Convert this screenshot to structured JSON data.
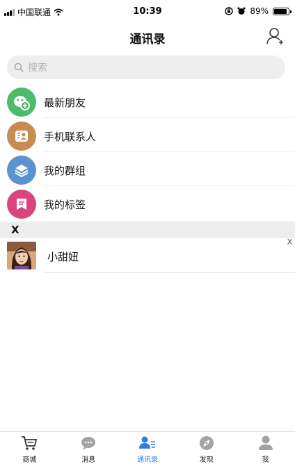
{
  "status_bar": {
    "carrier": "中国联通",
    "time": "10:39",
    "battery": "89%",
    "battery_level": 0.89
  },
  "nav": {
    "title": "通讯录",
    "add_friend_icon": "add-user-icon"
  },
  "search": {
    "placeholder": "搜索"
  },
  "menu": [
    {
      "label": "最新朋友",
      "icon": "new-friend-icon",
      "color": "#4cbb6c"
    },
    {
      "label": "手机联系人",
      "icon": "phone-contacts-icon",
      "color": "#c98b52"
    },
    {
      "label": "我的群组",
      "icon": "group-icon",
      "color": "#5b93d0"
    },
    {
      "label": "我的标签",
      "icon": "tag-icon",
      "color": "#d9457e"
    }
  ],
  "section": {
    "letter": "X"
  },
  "contacts": [
    {
      "name": "小甜妞"
    }
  ],
  "index_bar": {
    "letter": "X"
  },
  "tabs": [
    {
      "label": "商城",
      "icon": "cart-icon",
      "active": false
    },
    {
      "label": "消息",
      "icon": "message-icon",
      "active": false
    },
    {
      "label": "通讯录",
      "icon": "contacts-icon",
      "active": true
    },
    {
      "label": "发现",
      "icon": "discover-icon",
      "active": false
    },
    {
      "label": "我",
      "icon": "me-icon",
      "active": false
    }
  ],
  "colors": {
    "accent": "#2f7be9",
    "inactive_icon": "#9a9a9a"
  }
}
